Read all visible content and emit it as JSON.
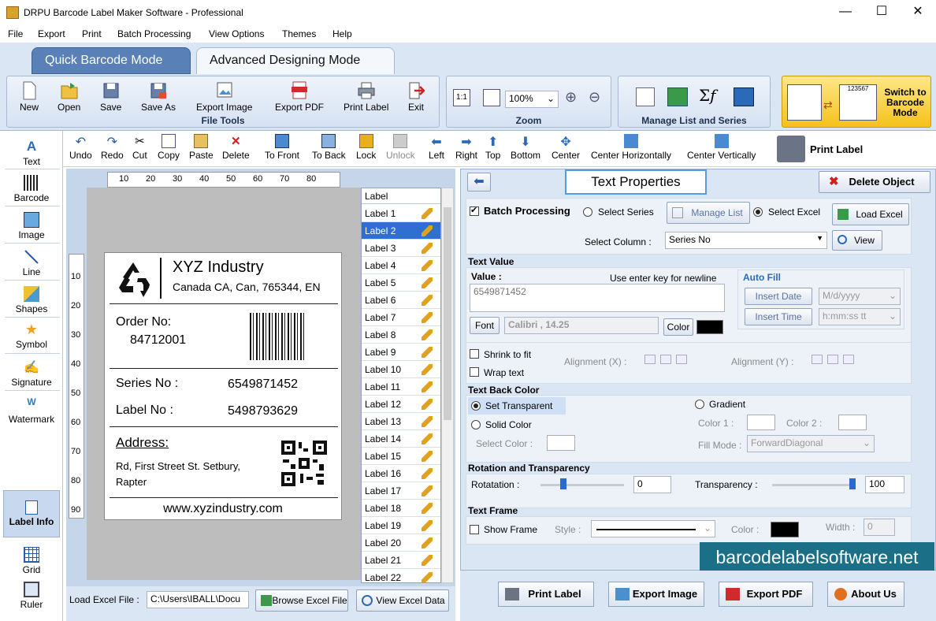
{
  "window": {
    "title": "DRPU Barcode Label Maker Software - Professional",
    "minimize": "—",
    "maximize": "☐",
    "close": "✕"
  },
  "menu": [
    "File",
    "Export",
    "Print",
    "Batch Processing",
    "View Options",
    "Themes",
    "Help"
  ],
  "mode_tabs": {
    "quick": "Quick Barcode Mode",
    "advanced": "Advanced Designing Mode"
  },
  "ribbon": {
    "file_tools": {
      "title": "File Tools",
      "buttons": [
        "New",
        "Open",
        "Save",
        "Save As",
        "Export Image",
        "Export PDF",
        "Print Label",
        "Exit"
      ]
    },
    "zoom": {
      "title": "Zoom",
      "value": "100%"
    },
    "manage": {
      "title": "Manage List and Series"
    },
    "switch": {
      "label": "Switch to Barcode Mode",
      "code": "123567"
    }
  },
  "left_tools": [
    "Text",
    "Barcode",
    "Image",
    "Line",
    "Shapes",
    "Symbol",
    "Signature",
    "Watermark",
    "Label Info",
    "Grid",
    "Ruler"
  ],
  "edit_toolbar": [
    "Undo",
    "Redo",
    "Cut",
    "Copy",
    "Paste",
    "Delete",
    "To Front",
    "To Back",
    "Lock",
    "Unlock",
    "Left",
    "Right",
    "Top",
    "Bottom",
    "Center",
    "Center Horizontally",
    "Center Vertically",
    "Print Label"
  ],
  "ruler": {
    "h": [
      "10",
      "20",
      "30",
      "40",
      "50",
      "60",
      "70",
      "80"
    ],
    "v": [
      "10",
      "20",
      "30",
      "40",
      "50",
      "60",
      "70",
      "80",
      "90"
    ]
  },
  "label_card": {
    "company": "XYZ Industry",
    "address_line": "Canada CA, Can, 765344, EN",
    "order_label": "Order No:",
    "order_value": "84712001",
    "series_label": "Series No :",
    "series_value": "6549871452",
    "labelno_label": "Label No :",
    "labelno_value": "5498793629",
    "address_title": "Address:",
    "address_1": "Rd, First Street St. Setbury,",
    "address_2": "Rapter",
    "website": "www.xyzindustry.com"
  },
  "label_list": {
    "header": "Label",
    "items": [
      "Label 1",
      "Label 2",
      "Label 3",
      "Label 4",
      "Label 5",
      "Label 6",
      "Label 7",
      "Label 8",
      "Label 9",
      "Label 10",
      "Label 11",
      "Label 12",
      "Label 13",
      "Label 14",
      "Label 15",
      "Label 16",
      "Label 17",
      "Label 18",
      "Label 19",
      "Label 20",
      "Label 21",
      "Label 22"
    ],
    "selected_index": 1
  },
  "excel": {
    "label": "Load Excel File :",
    "path": "C:\\Users\\IBALL\\Docu",
    "browse": "Browse Excel File",
    "view": "View Excel Data"
  },
  "props": {
    "title": "Text Properties",
    "delete": "Delete Object",
    "batch": "Batch Processing",
    "select_series": "Select Series",
    "manage_list": "Manage List",
    "select_excel": "Select Excel",
    "load_excel": "Load Excel",
    "select_column_label": "Select Column :",
    "select_column_value": "Series No",
    "view": "View",
    "text_value_title": "Text Value",
    "value_label": "Value :",
    "newline_hint": "Use enter key for newline",
    "value": "6549871452",
    "font_btn": "Font",
    "font_value": "Calibri , 14.25",
    "color_btn": "Color",
    "auto_fill": "Auto Fill",
    "insert_date": "Insert Date",
    "date_format": "M/d/yyyy",
    "insert_time": "Insert Time",
    "time_format": "h:mm:ss tt",
    "shrink": "Shrink to fit",
    "wrap": "Wrap text",
    "align_x": "Alignment (X) :",
    "align_y": "Alignment (Y) :",
    "back_color_title": "Text Back Color",
    "set_transparent": "Set Transparent",
    "solid_color": "Solid Color",
    "select_color": "Select Color :",
    "gradient": "Gradient",
    "color1": "Color 1 :",
    "color2": "Color 2 :",
    "fill_mode_label": "Fill Mode :",
    "fill_mode_value": "ForwardDiagonal",
    "rotation_title": "Rotation and Transparency",
    "rotation_label": "Rotatation :",
    "rotation_value": "0",
    "transparency_label": "Transparency :",
    "transparency_value": "100",
    "frame_title": "Text Frame",
    "show_frame": "Show Frame",
    "style_label": "Style :",
    "color_label": "Color :",
    "width_label": "Width :",
    "width_value": "0"
  },
  "bottom_buttons": [
    "Print Label",
    "Export Image",
    "Export PDF",
    "About Us"
  ],
  "watermark": "barcodelabelsoftware.net"
}
